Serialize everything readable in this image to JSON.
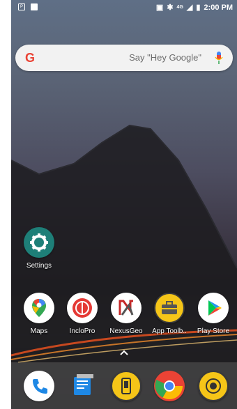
{
  "status_bar": {
    "time": "2:00 PM",
    "network": "4G",
    "left_icons": [
      "screenshot-icon",
      "image-icon"
    ],
    "right_icons": [
      "nfc-icon",
      "bluetooth-icon",
      "signal-icon",
      "battery-icon"
    ]
  },
  "search": {
    "placeholder": "Say \"Hey Google\"",
    "logo": "G"
  },
  "home_apps": [
    {
      "label": "Settings",
      "icon": "gear-icon"
    }
  ],
  "app_row": [
    {
      "label": "Maps",
      "icon": "maps-icon"
    },
    {
      "label": "IncloPro",
      "icon": "inclopro-icon"
    },
    {
      "label": "NexusGeo",
      "icon": "nexusgeo-icon"
    },
    {
      "label": "App Toolb..",
      "icon": "toolbox-icon"
    },
    {
      "label": "Play Store",
      "icon": "play-store-icon"
    }
  ],
  "dock": [
    {
      "label": "Phone",
      "icon": "phone-icon"
    },
    {
      "label": "Messages",
      "icon": "messages-icon"
    },
    {
      "label": "Device",
      "icon": "device-icon"
    },
    {
      "label": "Chrome",
      "icon": "chrome-icon"
    },
    {
      "label": "Camera",
      "icon": "camera-icon"
    }
  ],
  "colors": {
    "accent_teal": "#1e7f78",
    "google_blue": "#4285f4",
    "inclopro_red": "#e53935",
    "toolbox_yellow": "#f5c518",
    "phone_blue": "#1e88e5"
  }
}
